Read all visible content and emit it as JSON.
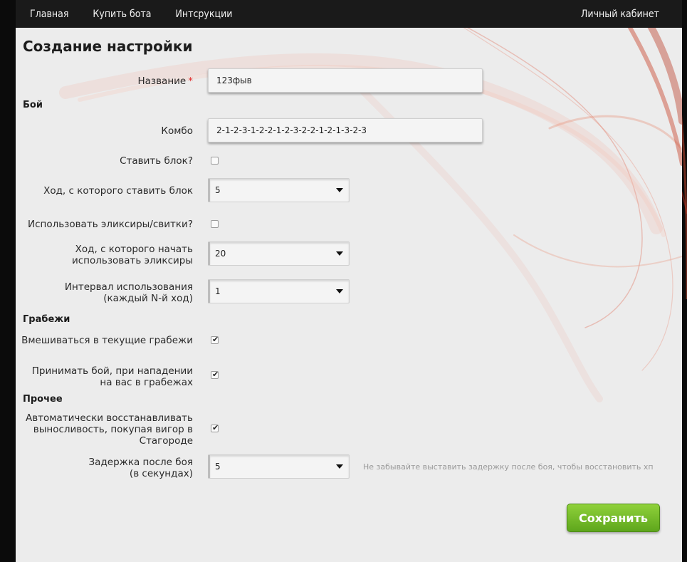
{
  "nav": {
    "home": "Главная",
    "buy_bot": "Купить бота",
    "instructions": "Интсрукции",
    "account": "Личный кабинет"
  },
  "page_title": "Создание настройки",
  "form": {
    "name": {
      "label": "Название",
      "required_mark": "*",
      "value": "123фыв"
    },
    "sections": {
      "fight": "Бой",
      "robbery": "Грабежи",
      "other": "Прочее"
    },
    "combo": {
      "label": "Комбо",
      "value": "2-1-2-3-1-2-2-1-2-3-2-2-1-2-1-3-2-3"
    },
    "block": {
      "label": "Ставить блок?",
      "checked": false
    },
    "block_turn": {
      "label": "Ход, с которого ставить блок",
      "value": "5"
    },
    "use_elixirs": {
      "label": "Использовать эликсиры/свитки?",
      "checked": false
    },
    "elixir_start": {
      "label_line1": "Ход, с которого начать",
      "label_line2": "использовать эликсиры",
      "value": "20"
    },
    "interval": {
      "label_line1": "Интервал использования",
      "label_line2": "(каждый N-й ход)",
      "value": "1"
    },
    "join_robbery": {
      "label": "Вмешиваться в текущие грабежи",
      "checked": true
    },
    "accept_fight": {
      "label_line1": "Принимать бой, при нападении",
      "label_line2": "на вас в грабежах",
      "checked": true
    },
    "auto_restore": {
      "label_line1": "Автоматически восстанавливать",
      "label_line2": "выносливость, покупая вигор в",
      "label_line3": "Стагороде",
      "checked": true
    },
    "delay": {
      "label_line1": "Задержка после боя",
      "label_line2": "(в секундах)",
      "value": "5",
      "hint": "Не забывайте выставить задержку после боя, чтобы восстановить хп"
    }
  },
  "save_button": "Сохранить",
  "colors": {
    "accent_green": "#6cb523",
    "required_red": "#e02a2a",
    "nav_bg": "#1a1a1a"
  }
}
